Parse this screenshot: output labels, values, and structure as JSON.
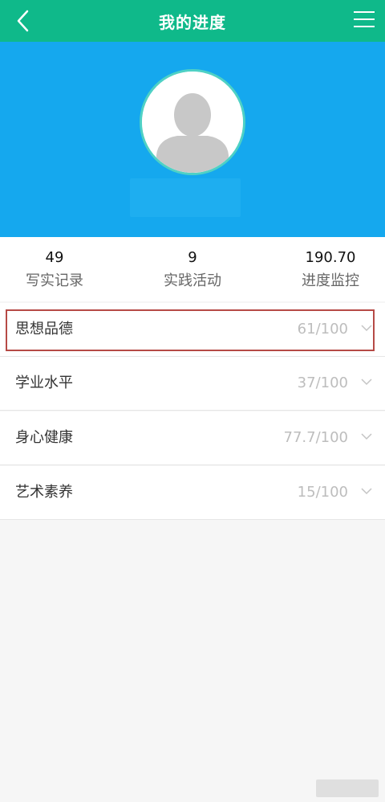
{
  "header": {
    "title": "我的进度",
    "back_icon": "chevron-left-icon",
    "menu_icon": "hamburger-menu-icon",
    "color": "#0fb98a"
  },
  "profile": {
    "avatar_icon": "user-avatar-icon",
    "hero_color": "#15a8ee"
  },
  "stats": [
    {
      "value": "49",
      "label": "写实记录"
    },
    {
      "value": "9",
      "label": "实践活动"
    },
    {
      "value": "190.70",
      "label": "进度监控"
    }
  ],
  "categories": [
    {
      "label": "思想品德",
      "score": "61/100",
      "selected": true
    },
    {
      "label": "学业水平",
      "score": "37/100"
    },
    {
      "label": "身心健康",
      "score": "77.7/100"
    },
    {
      "label": "艺术素养",
      "score": "15/100"
    }
  ]
}
